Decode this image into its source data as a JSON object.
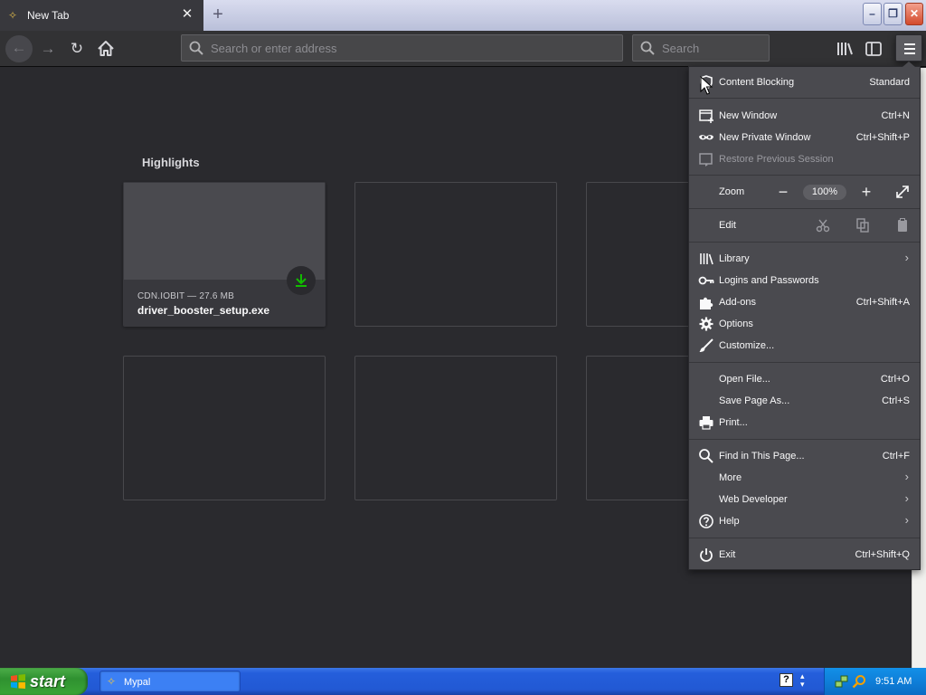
{
  "browser": {
    "tab": {
      "title": "New Tab"
    },
    "address_placeholder": "Search or enter address",
    "search_placeholder": "Search"
  },
  "newtab": {
    "section_title": "Highlights",
    "card": {
      "host": "CDN.IOBIT — 27.6 MB",
      "filename": "driver_booster_setup.exe"
    }
  },
  "menu": {
    "content_blocking": {
      "label": "Content Blocking",
      "value": "Standard"
    },
    "new_window": {
      "label": "New Window",
      "shortcut": "Ctrl+N"
    },
    "new_private_window": {
      "label": "New Private Window",
      "shortcut": "Ctrl+Shift+P"
    },
    "restore_session": {
      "label": "Restore Previous Session"
    },
    "zoom": {
      "label": "Zoom",
      "minus": "−",
      "value": "100%",
      "plus": "+"
    },
    "edit": {
      "label": "Edit"
    },
    "library": {
      "label": "Library"
    },
    "logins": {
      "label": "Logins and Passwords"
    },
    "addons": {
      "label": "Add-ons",
      "shortcut": "Ctrl+Shift+A"
    },
    "options": {
      "label": "Options"
    },
    "customize": {
      "label": "Customize..."
    },
    "open_file": {
      "label": "Open File...",
      "shortcut": "Ctrl+O"
    },
    "save_page": {
      "label": "Save Page As...",
      "shortcut": "Ctrl+S"
    },
    "print": {
      "label": "Print..."
    },
    "find": {
      "label": "Find in This Page...",
      "shortcut": "Ctrl+F"
    },
    "more": {
      "label": "More"
    },
    "web_developer": {
      "label": "Web Developer"
    },
    "help": {
      "label": "Help"
    },
    "exit": {
      "label": "Exit",
      "shortcut": "Ctrl+Shift+Q"
    }
  },
  "taskbar": {
    "start_label": "start",
    "task_label": "Mypal",
    "help_glyph": "?",
    "clock": "9:51 AM"
  },
  "colors": {
    "page_bg": "#2a2a2e",
    "menu_bg": "#4a4a4f",
    "download_green": "#12bc00",
    "xp_blue": "#245edb",
    "start_green": "#3aa536"
  },
  "icons": [
    "tab-favicon-icon",
    "close-icon",
    "plus-icon",
    "back-arrow-icon",
    "forward-arrow-icon",
    "reload-icon",
    "home-icon",
    "search-icon",
    "library-icon",
    "sidebar-icon",
    "hamburger-menu-icon",
    "download-icon",
    "shield-icon",
    "window-icon",
    "mask-icon",
    "restore-icon",
    "fullscreen-icon",
    "cut-icon",
    "copy-icon",
    "paste-icon",
    "puzzle-icon",
    "key-icon",
    "gear-icon",
    "brush-icon",
    "printer-icon",
    "help-icon",
    "power-icon",
    "windows-flag-icon",
    "clock"
  ]
}
